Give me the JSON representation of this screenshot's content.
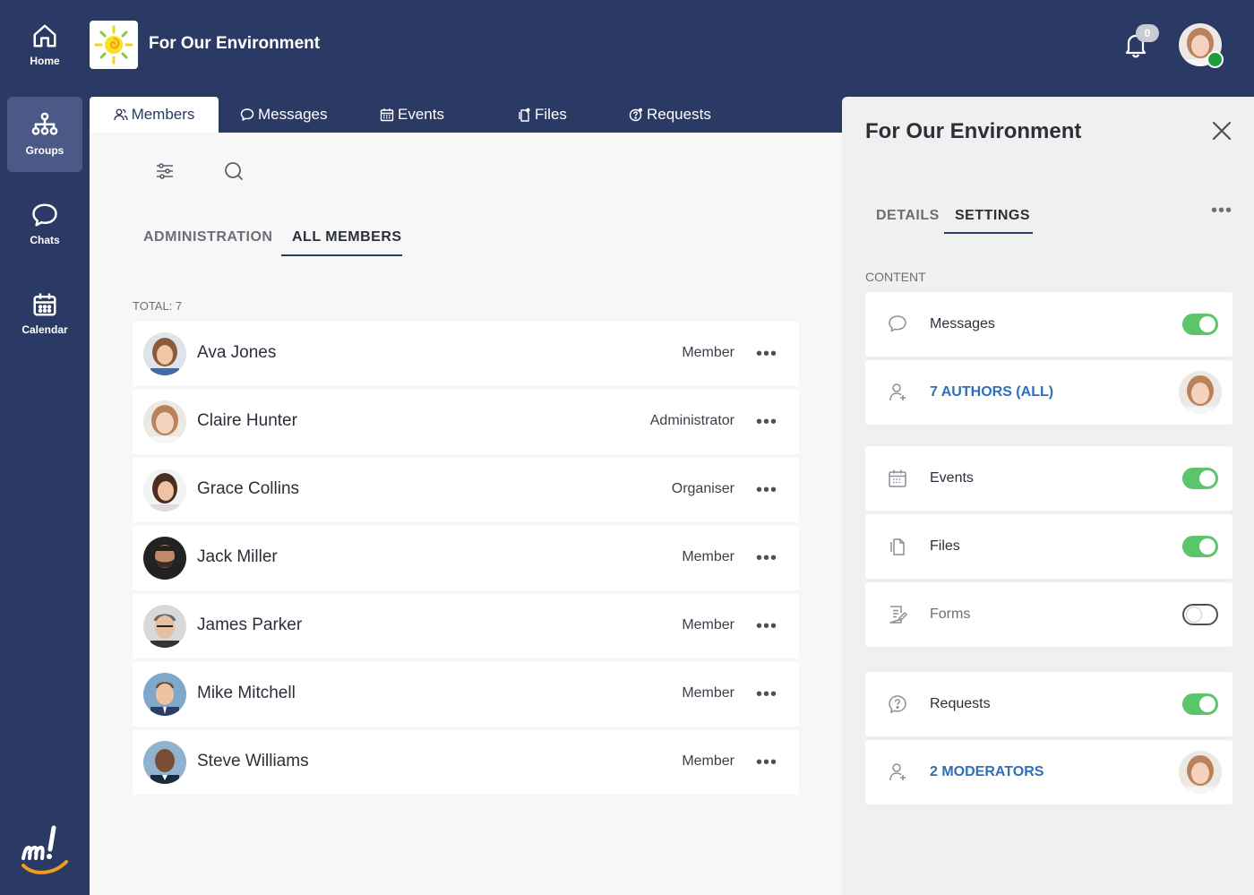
{
  "rail": {
    "items": [
      {
        "label": "Home",
        "icon": "home-icon"
      },
      {
        "label": "Groups",
        "icon": "groups-icon"
      },
      {
        "label": "Chats",
        "icon": "chat-icon"
      },
      {
        "label": "Calendar",
        "icon": "calendar-icon"
      }
    ]
  },
  "header": {
    "title": "For Our Environment",
    "notifications_count": "0"
  },
  "tabs": [
    "Members",
    "Messages",
    "Events",
    "Files",
    "Requests"
  ],
  "members": {
    "subtabs": [
      "ADMINISTRATION",
      "ALL MEMBERS"
    ],
    "total": "TOTAL: 7",
    "list": [
      {
        "name": "Ava Jones",
        "role": "Member"
      },
      {
        "name": "Claire Hunter",
        "role": "Administrator"
      },
      {
        "name": "Grace Collins",
        "role": "Organiser"
      },
      {
        "name": "Jack Miller",
        "role": "Member"
      },
      {
        "name": "James Parker",
        "role": "Member"
      },
      {
        "name": "Mike Mitchell",
        "role": "Member"
      },
      {
        "name": "Steve Williams",
        "role": "Member"
      }
    ]
  },
  "side": {
    "title": "For Our Environment",
    "tabs": [
      "DETAILS",
      "SETTINGS"
    ],
    "section": "CONTENT",
    "settings": [
      {
        "label": "Messages",
        "enabled": true
      },
      {
        "label": "7 AUTHORS (ALL)"
      },
      {
        "label": "Events",
        "enabled": true
      },
      {
        "label": "Files",
        "enabled": true
      },
      {
        "label": "Forms",
        "enabled": false
      },
      {
        "label": "Requests",
        "enabled": true
      },
      {
        "label": "2 MODERATORS"
      }
    ]
  },
  "colors": {
    "navy": "#2b3a64",
    "toggle_on": "#5cc46b",
    "link": "#2f6fb7"
  }
}
